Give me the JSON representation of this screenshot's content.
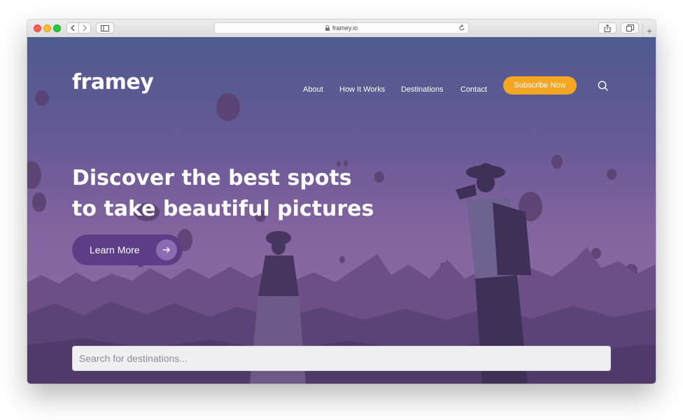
{
  "browser": {
    "url": "framey.io",
    "plus": "+"
  },
  "site": {
    "logo": "framey",
    "nav": [
      "About",
      "How It Works",
      "Destinations",
      "Contact"
    ],
    "subscribe": "Subscribe Now"
  },
  "hero": {
    "headline_line1": "Discover the best spots",
    "headline_line2": "to take beautiful pictures",
    "cta": "Learn More",
    "search_placeholder": "Search for destinations..."
  },
  "colors": {
    "accent": "#f5a623",
    "cta": "#5d3e86",
    "overlay": "#6b5a96"
  }
}
